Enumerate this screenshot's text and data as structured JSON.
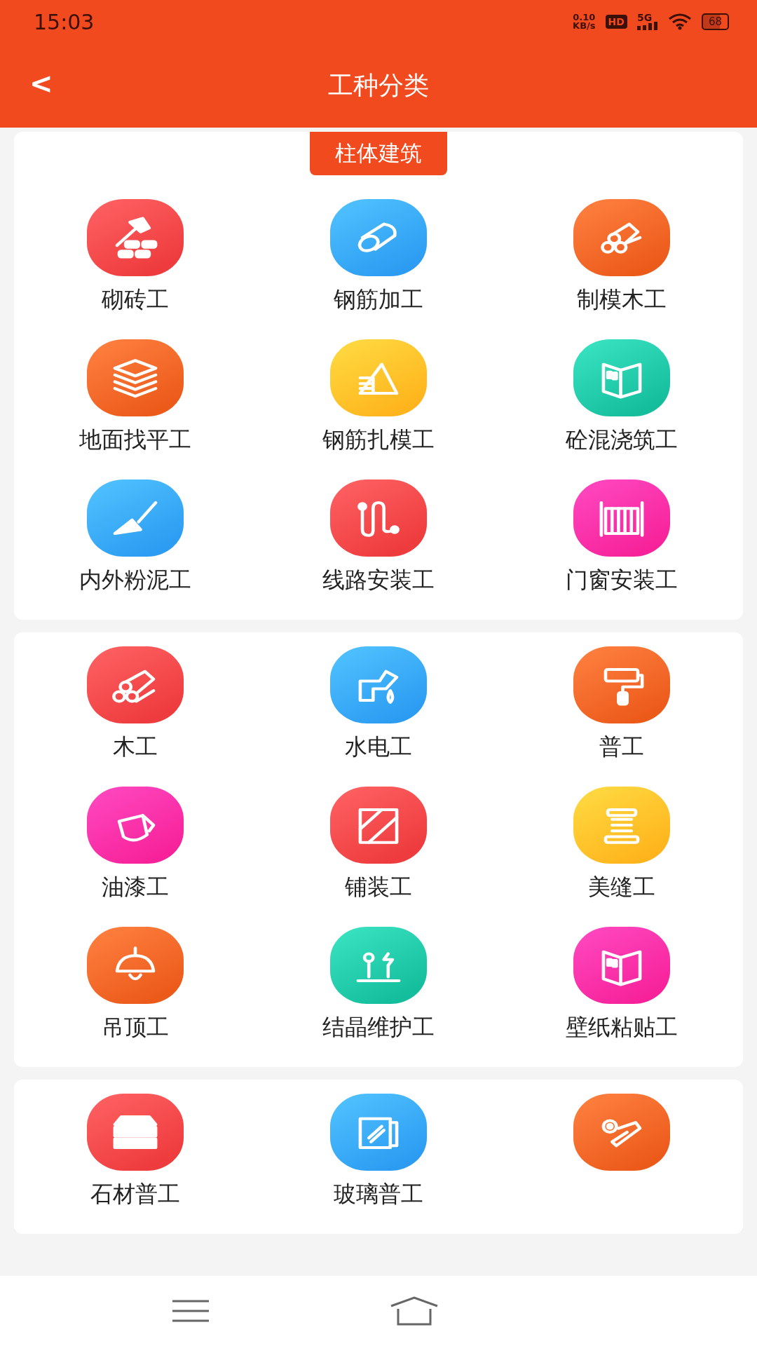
{
  "status_bar": {
    "time": "15:03",
    "speed": "0.10",
    "speed_unit": "KB/s",
    "hd": "HD",
    "network": "5G",
    "battery": "68"
  },
  "header": {
    "back": "<",
    "title": "工种分类"
  },
  "sections": [
    {
      "tag": "柱体建筑",
      "items": [
        {
          "label": "砌砖工",
          "color": "#ee3b3d"
        },
        {
          "label": "钢筋加工",
          "color": "#2b9cf2"
        },
        {
          "label": "制模木工",
          "color": "#ec5a1a"
        },
        {
          "label": "地面找平工",
          "color": "#ec5a1a"
        },
        {
          "label": "钢筋扎模工",
          "color": "#ffb41c"
        },
        {
          "label": "砼混浇筑工",
          "color": "#14bd9b"
        },
        {
          "label": "内外粉泥工",
          "color": "#2b9cf2"
        },
        {
          "label": "线路安装工",
          "color": "#ee3b3d"
        },
        {
          "label": "门窗安装工",
          "color": "#f7229a"
        }
      ]
    },
    {
      "items": [
        {
          "label": "木工",
          "color": "#ee3b3d"
        },
        {
          "label": "水电工",
          "color": "#2b9cf2"
        },
        {
          "label": "普工",
          "color": "#ec5a1a"
        },
        {
          "label": "油漆工",
          "color": "#f7229a"
        },
        {
          "label": "铺装工",
          "color": "#ee3b3d"
        },
        {
          "label": "美缝工",
          "color": "#ffb41c"
        },
        {
          "label": "吊顶工",
          "color": "#ec5a1a"
        },
        {
          "label": "结晶维护工",
          "color": "#14bd9b"
        },
        {
          "label": "壁纸粘贴工",
          "color": "#f7229a"
        }
      ]
    },
    {
      "items": [
        {
          "label": "石材普工",
          "color": "#ee3b3d"
        },
        {
          "label": "玻璃普工",
          "color": "#2b9cf2"
        },
        {
          "color": "#ec5a1a"
        }
      ]
    }
  ]
}
